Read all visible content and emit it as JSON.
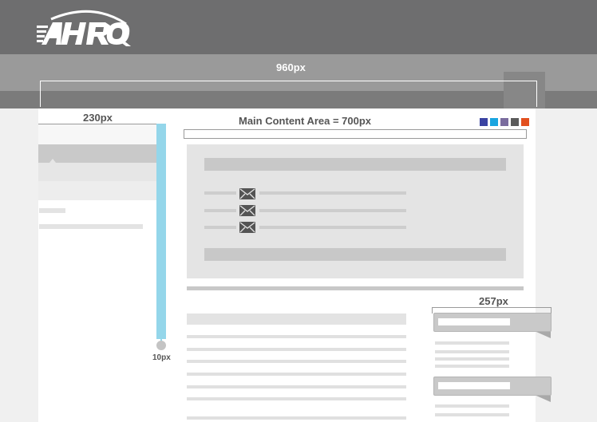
{
  "header": {
    "logo_text": "AHRQ",
    "width_label": "960px"
  },
  "sidebar": {
    "width_label": "230px",
    "gutter_label": "10px"
  },
  "main": {
    "width_label": "Main Content Area = 700px",
    "color_swatches": [
      "#3a43a2",
      "#1aa5e0",
      "#7a6c9e",
      "#5b5b5b",
      "#e2501f"
    ]
  },
  "aside": {
    "width_label": "257px"
  }
}
